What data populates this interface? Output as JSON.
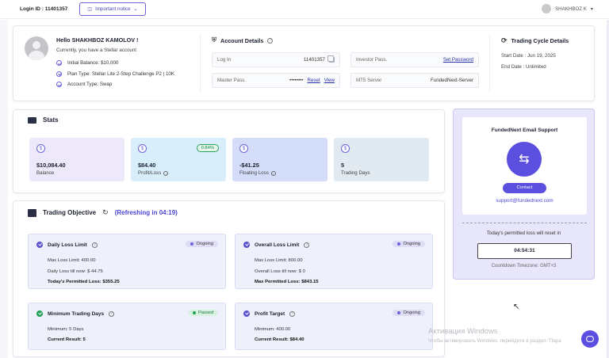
{
  "topbar": {
    "login_id": "Login ID : 11401357",
    "notice_label": "Important notice",
    "username": "SHAKHBOZ K"
  },
  "profile": {
    "greeting": "Hello SHAKHBOZ KAMOLOV !",
    "subtitle": "Currently, you have a Stellar account",
    "items": [
      "Initial Balance: $10,000",
      "Plan Type: Stellar Lite 2-Step Challenge P2 | 10K",
      "Account Type: Swap"
    ]
  },
  "account": {
    "title": "Account Details",
    "login_label": "Log In",
    "login_value": "11401357",
    "master_label": "Master Pass.",
    "master_value": "••••••••",
    "reset_label": "Reset",
    "view_label": "View",
    "investor_label": "Investor Pass.",
    "set_password_label": "Set Password",
    "server_label": "MT5 Server",
    "server_value": "FundedNext-Server"
  },
  "cycle": {
    "title": "Trading Cycle Details",
    "start": "Start Date : Jun 19, 2025",
    "end": "End Date : Unlimited"
  },
  "stats": {
    "title": "Stats",
    "boxes": [
      {
        "value": "$10,084.40",
        "label": "Balance",
        "bg": "#ede9fb"
      },
      {
        "value": "$84.40",
        "label": "Profit/Loss",
        "badge": "0.84%",
        "bg": "#d9eefb"
      },
      {
        "value": "-$41.25",
        "label": "Floating Loss",
        "bg": "#d3dcf8"
      },
      {
        "value": "5",
        "label": "Trading Days",
        "bg": "#e0eaf0"
      }
    ]
  },
  "objective": {
    "title": "Trading Objective",
    "refresh": "(Refreshing in 04:19)",
    "daily": {
      "title": "Daily Loss Limit",
      "status": "Ongoing",
      "l1": "Max Loss Limit: 400.00",
      "l2": "Daily Loss till now: $ 44.75",
      "l3": "Today's Permitted Loss: $355.25"
    },
    "overall": {
      "title": "Overall Loss Limit",
      "status": "Ongoing",
      "l1": "Max Loss Limit: 800.00",
      "l2": "Overall Loss till now: $ 0",
      "l3": "Max Permitted Loss: $843.15"
    },
    "min_days": {
      "title": "Minimum Trading Days",
      "status": "Passed",
      "l1": "Minimum: 5 Days",
      "l2": "Current Result: 5"
    },
    "profit": {
      "title": "Profit Target",
      "status": "Ongoing",
      "l1": "Minimum: 400.00",
      "l2": "Current Result: $84.40"
    }
  },
  "support": {
    "title": "FundedNext Email Support",
    "contact": "Contact",
    "email": "support@fundednext.com",
    "reset_text": "Today's permitted loss will reset in",
    "timer": "04:54:31",
    "timezone": "Countdown Timezone: GMT+3"
  },
  "watermark": {
    "line1": "Активация Windows",
    "line2": "Чтобы активировать Windows, перейдите в раздел \"Пара"
  },
  "colors": {
    "accent": "#5b4fe0",
    "link": "#2530a8",
    "passed": "#1fa052"
  }
}
